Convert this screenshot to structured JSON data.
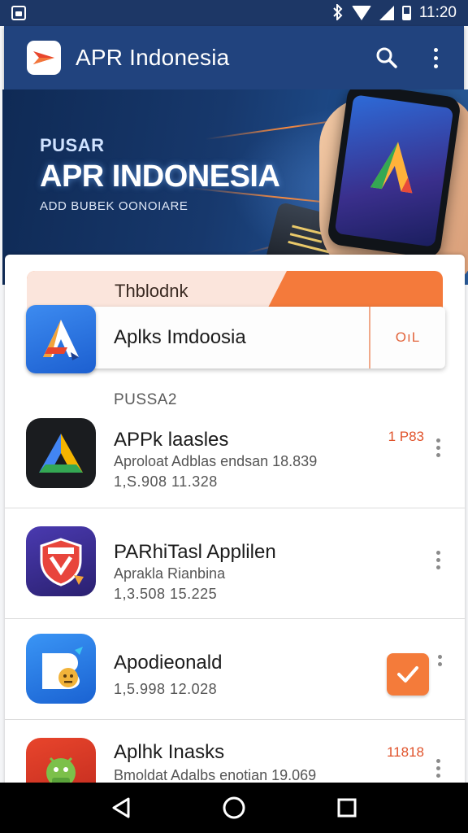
{
  "status_bar": {
    "time": "11:20",
    "icons": [
      "image-icon",
      "bluetooth-icon",
      "wifi-icon",
      "signal-icon",
      "battery-icon"
    ]
  },
  "app_bar": {
    "title": "APR Indonesia",
    "logo_icon": "play-logo-icon",
    "actions": [
      "search-icon",
      "more-vert-icon"
    ]
  },
  "banner": {
    "kicker": "PUSAR",
    "title": "APR INDONESIA",
    "subtitle": "ADD BUBEK OONOIARE"
  },
  "featured": {
    "tab_label": "Thblodnk",
    "app_name": "Aplks Imdoosia",
    "action_label": "OıL"
  },
  "section": {
    "label": "PUSSA2"
  },
  "apps": [
    {
      "title": "APPk laasles",
      "subtitle": "Aproloat Adblas endsan 18.839",
      "meta": "1,S.908  11.328",
      "badge": "1 P83",
      "icon": "triangle-logo-icon",
      "trailing": "badge"
    },
    {
      "title": "PARhiTasl Applilen",
      "subtitle": "Aprakla Rianbina",
      "meta": "1,3.508  15.225",
      "badge": "",
      "icon": "shield-icon",
      "trailing": "none"
    },
    {
      "title": "Apodieonald",
      "subtitle": "",
      "meta": "1,5.998  12.028",
      "badge": "",
      "icon": "chat-bubble-icon",
      "trailing": "check"
    },
    {
      "title": "Aplhk Inasks",
      "subtitle": "Bmoldat Adalbs enotian 19.069",
      "meta": "",
      "badge": "11818",
      "icon": "android-icon",
      "trailing": "badge"
    }
  ],
  "nav_bar": {
    "items": [
      "back-icon",
      "home-icon",
      "recents-icon"
    ]
  },
  "colors": {
    "primary": "#21437e",
    "accent": "#f47a3b",
    "badge_text": "#e0522a"
  }
}
